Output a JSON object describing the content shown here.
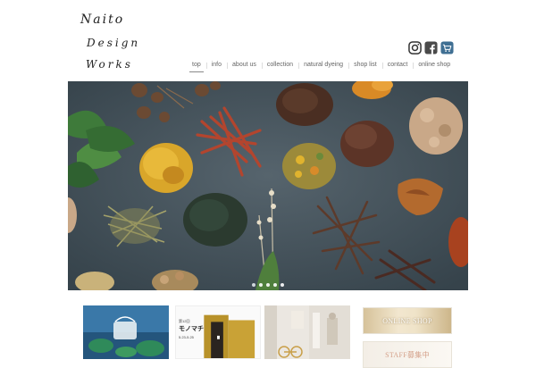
{
  "brand": {
    "logo_lines": [
      "Naito",
      "Design",
      "Works"
    ]
  },
  "social": {
    "icons": [
      "instagram-icon",
      "facebook-icon",
      "shop-cart-icon"
    ]
  },
  "nav": {
    "items": [
      "top",
      "info",
      "about us",
      "collection",
      "natural dyeing",
      "shop list",
      "contact",
      "online shop"
    ],
    "active": "top"
  },
  "hero": {
    "slide_count": 5,
    "active_slide": 1
  },
  "tiles": {
    "shop_name_jp": "モノマチ",
    "shop_sub": "第12回",
    "shop_date": "5.23-5.25"
  },
  "banners": {
    "online_shop": "ONLINE SHOP",
    "staff": "STAFF募集中"
  },
  "colors": {
    "hero_bg": "#3f4c55",
    "indigo": "#2b6b9e",
    "mustard": "#b8922a",
    "banner_gold": "#d6c29a"
  }
}
